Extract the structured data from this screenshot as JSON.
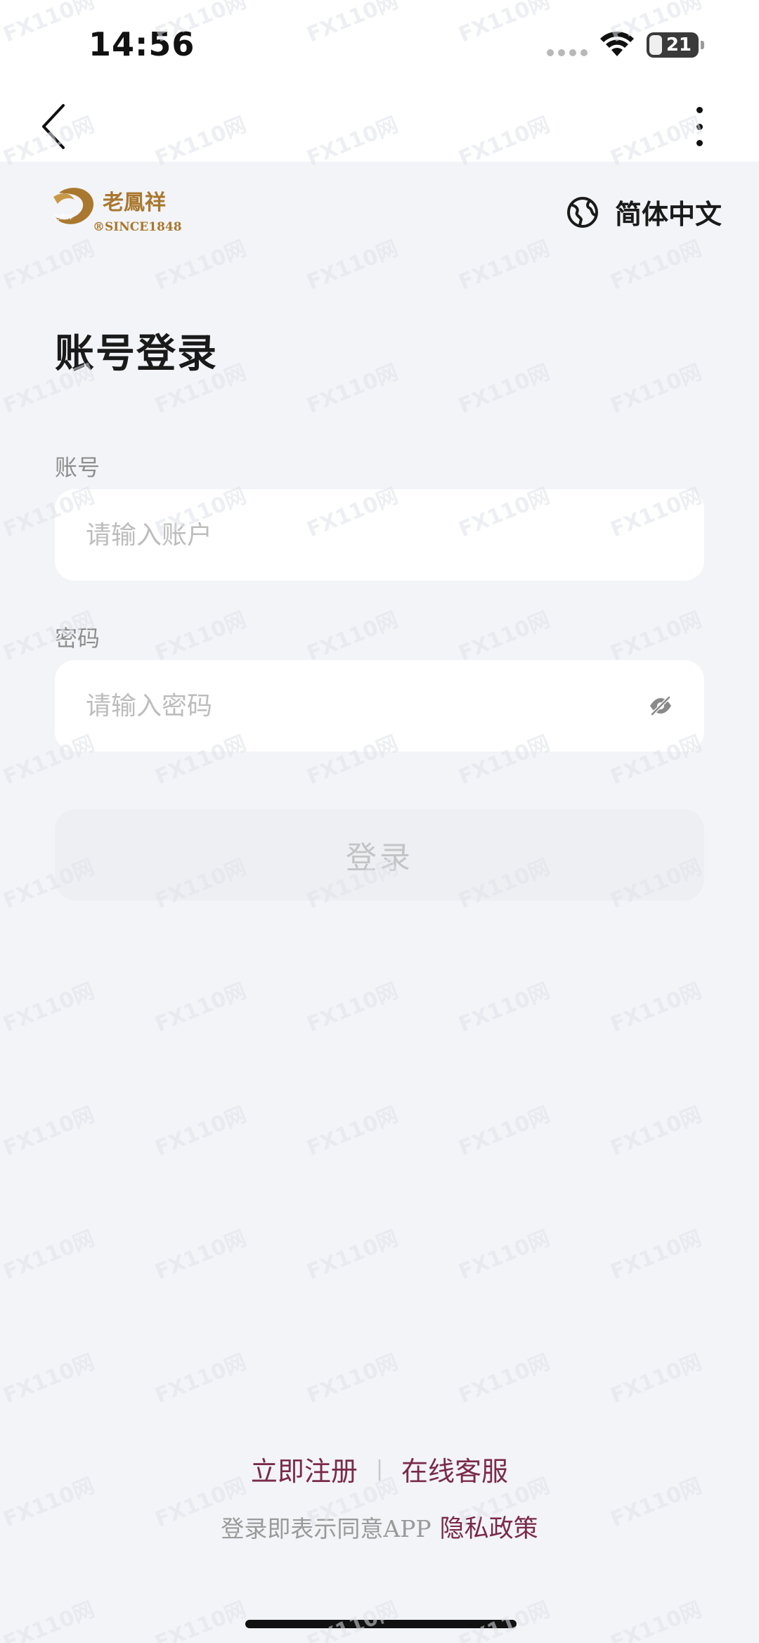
{
  "status_bar": {
    "time": "14:56",
    "battery_level": "21"
  },
  "header": {
    "language_label": "简体中文"
  },
  "brand": {
    "logo_text": "老鳳祥",
    "logo_since": "®SINCE1848",
    "logo_stamp": "老鳳祥"
  },
  "login": {
    "title": "账号登录",
    "account_label": "账号",
    "account_placeholder": "请输入账户",
    "account_value": "",
    "password_label": "密码",
    "password_placeholder": "请输入密码",
    "password_value": "",
    "submit_label": "登录"
  },
  "footer": {
    "register_label": "立即注册",
    "separator": "|",
    "support_label": "在线客服",
    "agreement_text": "登录即表示同意APP",
    "privacy_label": "隐私政策"
  },
  "watermark": {
    "text": "110网"
  },
  "colors": {
    "background": "#f3f4f8",
    "accent": "#7a2a4a",
    "logo_gold": "#a9782e",
    "button_disabled_bg": "#eeeff2",
    "button_disabled_text": "#c4c4c6"
  },
  "icons": {
    "back": "chevron-left-icon",
    "more": "more-vertical-icon",
    "language": "globe-icon",
    "password_visibility": "eye-off-icon",
    "wifi": "wifi-icon",
    "signal": "cellular-signal-icon",
    "battery": "battery-icon"
  }
}
